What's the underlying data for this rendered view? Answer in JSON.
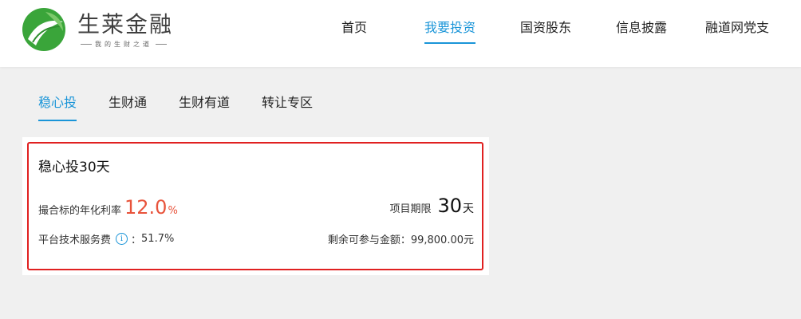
{
  "header": {
    "logo_title": "生莱金融",
    "logo_slogan": "我的生财之道",
    "nav": [
      {
        "label": "首页",
        "active": false
      },
      {
        "label": "我要投资",
        "active": true
      },
      {
        "label": "国资股东",
        "active": false
      },
      {
        "label": "信息披露",
        "active": false
      },
      {
        "label": "融道网党支",
        "active": false
      }
    ]
  },
  "subtabs": [
    {
      "label": "稳心投",
      "active": true
    },
    {
      "label": "生财通",
      "active": false
    },
    {
      "label": "生财有道",
      "active": false
    },
    {
      "label": "转让专区",
      "active": false
    }
  ],
  "product": {
    "title": "稳心投30天",
    "rate_label": "撮合标的年化利率",
    "rate_value": "12.0",
    "rate_unit": "%",
    "term_label": "项目期限",
    "term_value": "30",
    "term_unit": "天",
    "fee_label": "平台技术服务费",
    "fee_value": "51.7%",
    "fee_separator": "：",
    "remaining_label": "剩余可参与金额：",
    "remaining_value": "99,800.00元"
  },
  "colors": {
    "accent": "#1a95d8",
    "rate": "#e8533b",
    "highlight_border": "#e02020",
    "logo_green": "#3aa53a"
  },
  "icons": {
    "logo": "leaf-logo-icon",
    "info": "info-icon"
  }
}
